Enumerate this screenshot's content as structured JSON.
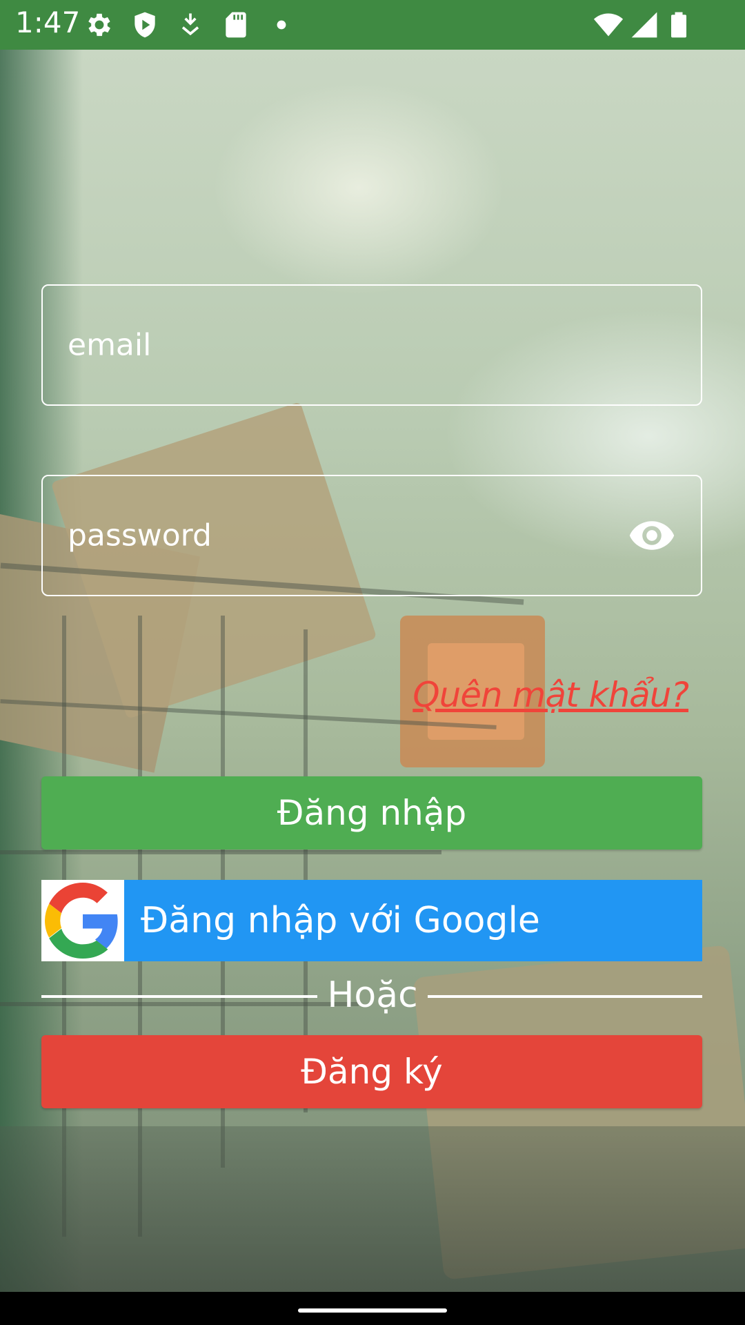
{
  "status_bar": {
    "time": "1:47",
    "icons_left": [
      "gear-icon",
      "shield-play-icon",
      "download-icon",
      "sd-card-icon",
      "dot-icon"
    ],
    "icons_right": [
      "wifi-icon",
      "signal-icon",
      "battery-icon"
    ]
  },
  "login_form": {
    "email_placeholder": "email",
    "email_value": "",
    "password_placeholder": "password",
    "password_value": "",
    "forgot_password_label": "Quên mật khẩu?",
    "login_button_label": "Đăng nhập",
    "google_button_label": "Đăng nhập với Google",
    "or_label": "Hoặc",
    "register_button_label": "Đăng ký"
  },
  "colors": {
    "status_bar": "#3f8a42",
    "login_button": "#4fad52",
    "google_button": "#2196f3",
    "register_button": "#e4453a",
    "forgot_link": "#f0443a"
  }
}
